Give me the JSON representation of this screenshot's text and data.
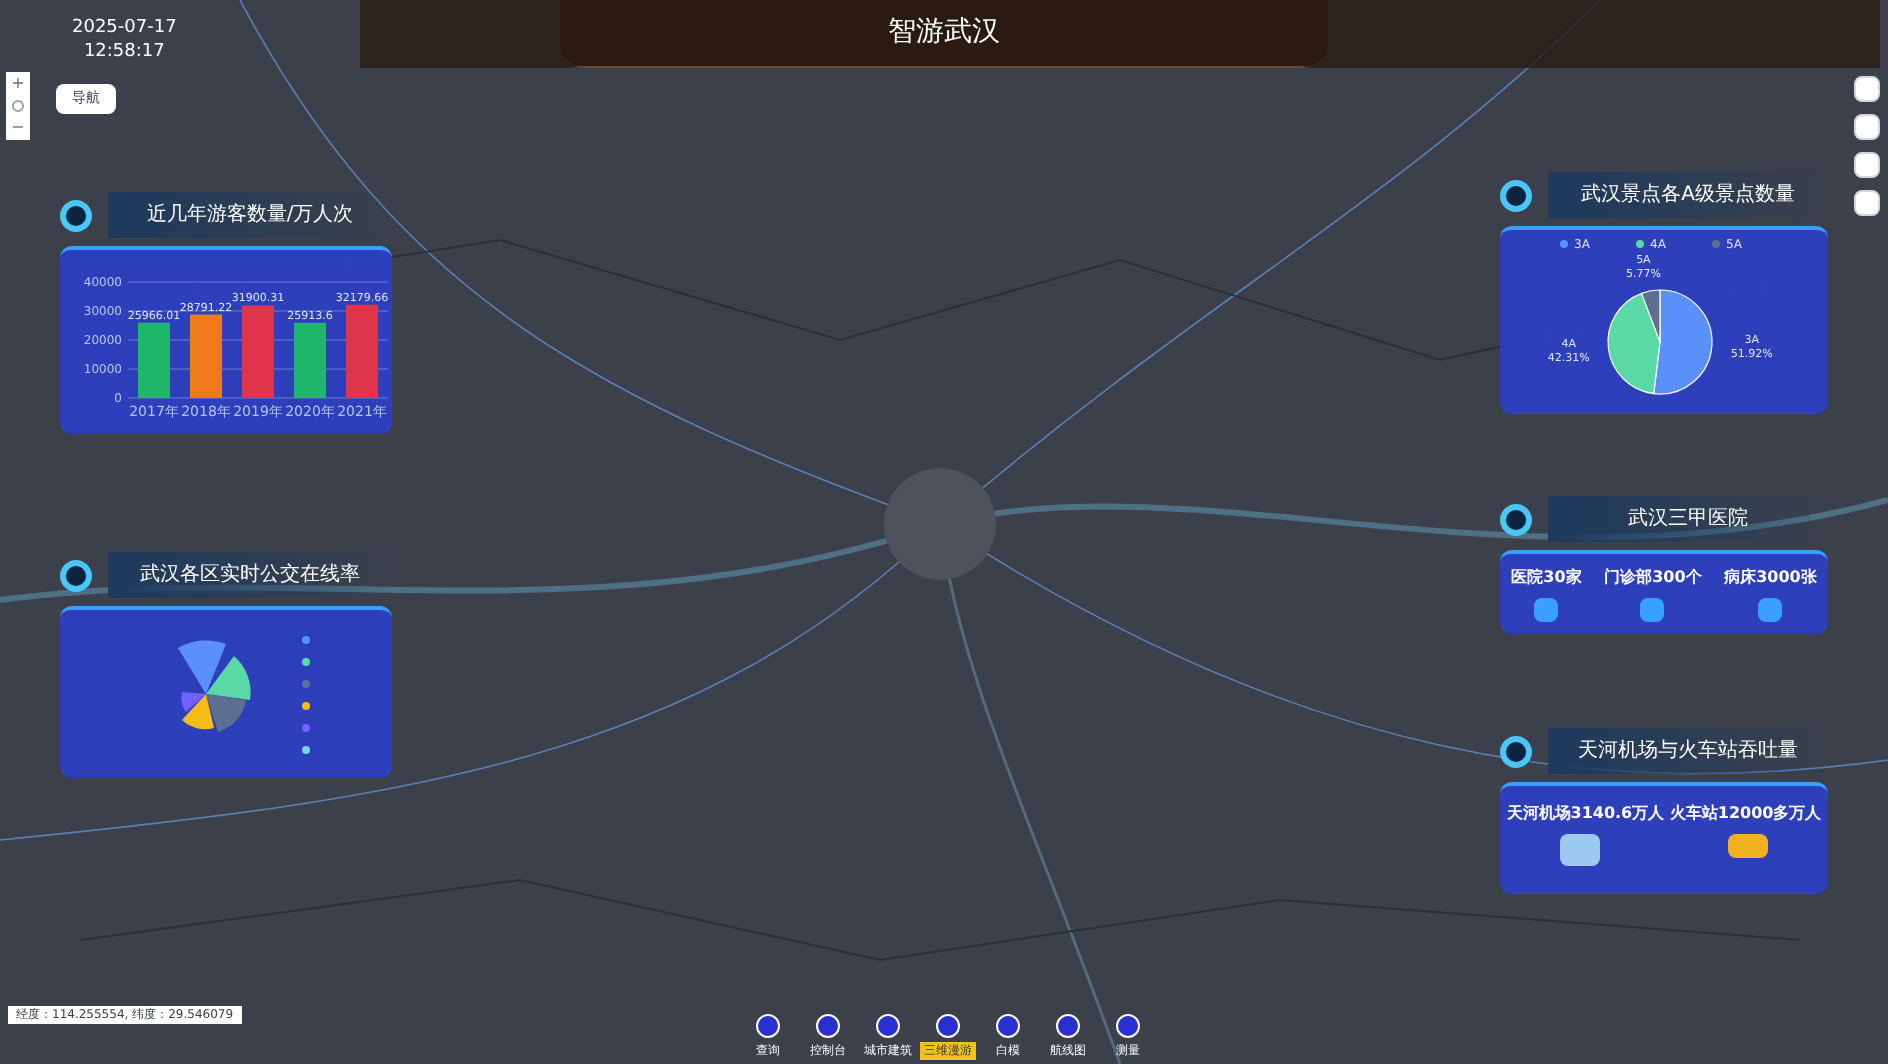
{
  "header": {
    "title": "智游武汉",
    "date": "2025-07-17",
    "time": "12:58:17"
  },
  "map_controls": {
    "zoom_in": "+",
    "zoom_out": "−",
    "nav_button": "导航"
  },
  "visitor_panel": {
    "title": "近几年游客数量/万人次",
    "chart_data": {
      "type": "bar",
      "categories": [
        "2017年",
        "2018年",
        "2019年",
        "2020年",
        "2021年"
      ],
      "values": [
        25966.01,
        28791.22,
        31900.31,
        25913.6,
        32179.66
      ],
      "ylim": [
        0,
        40000
      ],
      "yticks": [
        0,
        10000,
        20000,
        30000,
        40000
      ],
      "data_labels": true,
      "value_labels": [
        "25966.01",
        "28791.22",
        "31900.31",
        "25913.6",
        "32179.66"
      ],
      "colors": [
        "#1fb86a",
        "#f07a1a",
        "#e0344a",
        "#1fb86a",
        "#e0344a"
      ],
      "grid": true
    }
  },
  "bus_panel": {
    "title": "武汉各区实时公交在线率"
  },
  "scenic_panel": {
    "title": "武汉景点各A级景点数量",
    "chart_data": {
      "type": "pie",
      "categories": [
        "3A",
        "4A",
        "5A"
      ],
      "values": [
        51.92,
        42.31,
        5.77
      ],
      "data_labels": true,
      "value_labels": [
        "51.92%",
        "42.31%",
        "5.77%"
      ],
      "colors": [
        "#5b8ff9",
        "#5ad8a6",
        "#5d7092"
      ],
      "legend": "top"
    }
  },
  "hospital_panel": {
    "title": "武汉三甲医院",
    "stats": [
      "医院30家",
      "门诊部300个",
      "病床3000张"
    ]
  },
  "transport_panel": {
    "title": "天河机场与火车站吞吐量",
    "text": "天河机场3140.6万人 火车站12000多万人"
  },
  "toolbar": [
    {
      "label": "查询",
      "selected": false
    },
    {
      "label": "控制台",
      "selected": false
    },
    {
      "label": "城市建筑",
      "selected": false
    },
    {
      "label": "三维漫游",
      "selected": true
    },
    {
      "label": "白模",
      "selected": false
    },
    {
      "label": "航线图",
      "selected": false
    },
    {
      "label": "测量",
      "selected": false
    }
  ],
  "coordinates": "经度：114.255554, 纬度：29.546079"
}
